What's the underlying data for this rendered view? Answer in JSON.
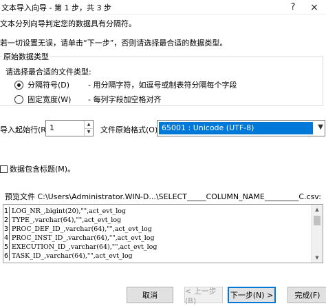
{
  "window": {
    "title": "文本导入向导 - 第 1 步，共 3 步",
    "help": "?",
    "close": "×"
  },
  "intro": {
    "line1": "文本分列向导判定您的数据具有分隔符。",
    "line2": "若一切设置无误，请单击“下一步”，否则请选择最合适的数据类型。"
  },
  "data_type": {
    "legend": "原始数据类型",
    "prompt": "请选择最合适的文件类型:",
    "options": [
      {
        "label": "分隔符号(D)",
        "desc": "- 用分隔字符，如逗号或制表符分隔每个字段",
        "checked": true
      },
      {
        "label": "固定宽度(W)",
        "desc": "- 每列字段加空格对齐",
        "checked": false
      }
    ]
  },
  "start_row": {
    "label": "导入起始行(R):",
    "value": "1"
  },
  "file_origin": {
    "label": "文件原始格式(O):",
    "value": "65001 : Unicode (UTF-8)"
  },
  "headers_checkbox": {
    "label": "数据包含标题(M)。",
    "checked": false
  },
  "preview": {
    "label": "预览文件 C:\\Users\\Administrator.WIN-D...\\SELECT_____COLUMN_NAME_________C.csv:",
    "lines": [
      {
        "num": "1",
        "text": "LOG_NR_,bigint(20),\"\",act_evt_log"
      },
      {
        "num": "2",
        "text": "TYPE_,varchar(64),\"\",act_evt_log"
      },
      {
        "num": "3",
        "text": "PROC_DEF_ID_,varchar(64),\"\",act_evt_log"
      },
      {
        "num": "4",
        "text": "PROC_INST_ID_,varchar(64),\"\",act_evt_log"
      },
      {
        "num": "5",
        "text": "EXECUTION_ID_,varchar(64),\"\",act_evt_log"
      },
      {
        "num": "6",
        "text": "TASK_ID_,varchar(64),\"\",act_evt_log"
      }
    ]
  },
  "buttons": {
    "cancel": "取消",
    "back": "< 上一步(B)",
    "next": "下一步(N) >",
    "finish": "完成(F)"
  }
}
